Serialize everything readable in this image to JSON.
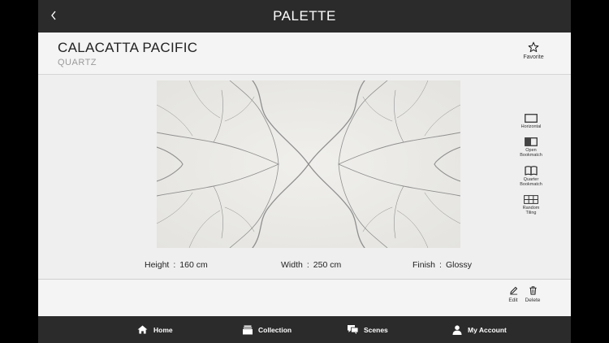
{
  "app": {
    "title": "PALETTE"
  },
  "product": {
    "name": "CALACATTA PACIFIC",
    "type": "QUARTZ"
  },
  "favorite": {
    "label": "Favorite",
    "icon": "star-icon"
  },
  "layout_options": [
    {
      "id": "horizontal",
      "lines": [
        "Horizontal"
      ],
      "icon": "horizontal-icon"
    },
    {
      "id": "open-bookmatch",
      "lines": [
        "Open",
        "Bookmatch"
      ],
      "icon": "open-bookmatch-icon"
    },
    {
      "id": "quarter-bookmatch",
      "lines": [
        "Quarter",
        "Bookmatch"
      ],
      "icon": "quarter-bookmatch-icon"
    },
    {
      "id": "random-tiling",
      "lines": [
        "Random",
        "Tiling"
      ],
      "icon": "random-tiling-icon"
    }
  ],
  "specs": [
    {
      "label": "Height",
      "value": "160 cm"
    },
    {
      "label": "Width",
      "value": "250 cm"
    },
    {
      "label": "Finish",
      "value": "Glossy"
    }
  ],
  "spec_separator": ":",
  "actions": {
    "edit_label": "Edit",
    "delete_label": "Delete"
  },
  "bottom_nav": [
    {
      "label": "Home",
      "icon": "home-icon"
    },
    {
      "label": "Collection",
      "icon": "collection-icon"
    },
    {
      "label": "Scenes",
      "icon": "scenes-icon"
    },
    {
      "label": "My Account",
      "icon": "account-icon"
    }
  ],
  "colors": {
    "bar": "#2b2b2b",
    "background": "#efefef",
    "slab": "#ebeae6",
    "vein": "#8f8f8f"
  }
}
